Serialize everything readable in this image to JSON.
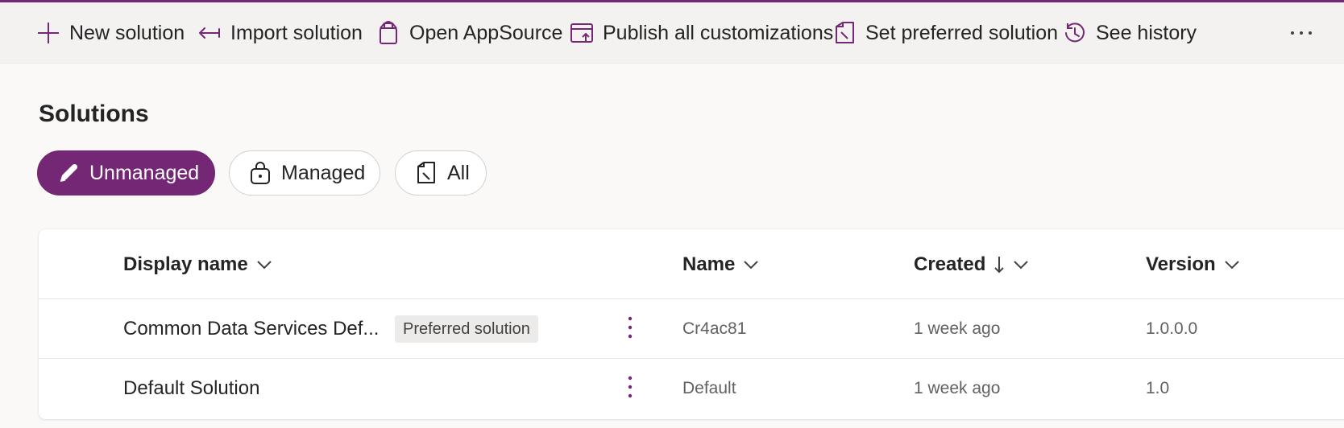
{
  "colors": {
    "accent": "#742774",
    "icon": "#742774",
    "commandbar_bg": "#f3f2f1",
    "page_bg": "#faf9f8",
    "badge_bg": "#edebe9"
  },
  "commandbar": {
    "items": [
      {
        "label": "New solution",
        "icon": "plus-icon"
      },
      {
        "label": "Import solution",
        "icon": "import-arrow-icon"
      },
      {
        "label": "Open AppSource",
        "icon": "shopping-bag-icon"
      },
      {
        "label": "Publish all customizations",
        "icon": "publish-window-icon"
      },
      {
        "label": "Set preferred solution",
        "icon": "preferred-solution-icon"
      },
      {
        "label": "See history",
        "icon": "history-icon"
      }
    ],
    "more_icon": "more-horizontal-icon"
  },
  "page": {
    "title": "Solutions"
  },
  "filters": [
    {
      "label": "Unmanaged",
      "icon": "pencil-icon",
      "selected": true
    },
    {
      "label": "Managed",
      "icon": "lock-bag-icon",
      "selected": false
    },
    {
      "label": "All",
      "icon": "solutions-all-icon",
      "selected": false
    }
  ],
  "grid": {
    "columns": [
      {
        "label": "Display name",
        "sorted": false
      },
      {
        "label": "Name",
        "sorted": false
      },
      {
        "label": "Created",
        "sorted": "descending"
      },
      {
        "label": "Version",
        "sorted": false
      }
    ],
    "rows": [
      {
        "display_name": "Common Data Services Def...",
        "badge": "Preferred solution",
        "name": "Cr4ac81",
        "created": "1 week ago",
        "version": "1.0.0.0"
      },
      {
        "display_name": "Default Solution",
        "badge": "",
        "name": "Default",
        "created": "1 week ago",
        "version": "1.0"
      }
    ]
  }
}
